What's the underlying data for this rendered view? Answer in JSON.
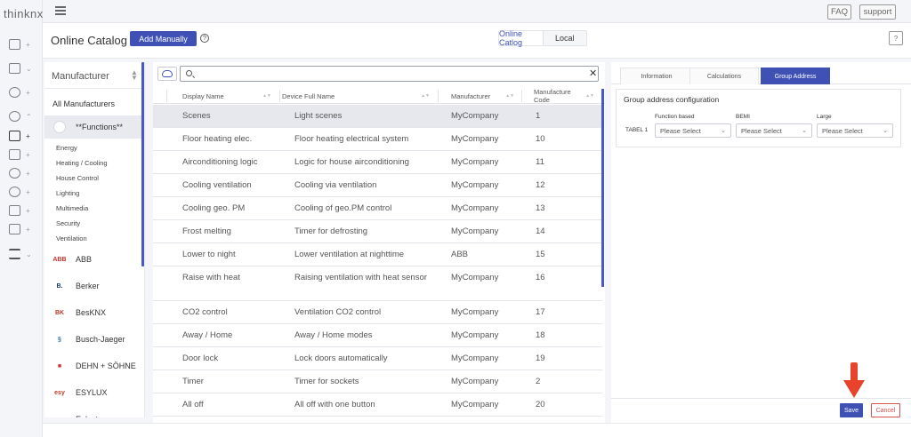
{
  "app": {
    "logo": "thinknx"
  },
  "topbar": {
    "faq": "FAQ",
    "support": "support"
  },
  "header": {
    "title": "Online Catalog",
    "add_manually": "Add Manually",
    "help": "?",
    "toggle_online": "Online Catlog",
    "toggle_local": "Local",
    "side_button": "?"
  },
  "manufacturer": {
    "title": "Manufacturer",
    "all": "All Manufacturers",
    "functions": "**Functions**",
    "subcategories": [
      "Energy",
      "Heating / Cooling",
      "House Control",
      "Lighting",
      "Multimedia",
      "Security",
      "Ventilation"
    ],
    "brands": [
      {
        "name": "ABB",
        "logo": "ABB",
        "color": "#d32f2f"
      },
      {
        "name": "Berker",
        "logo": "B.",
        "color": "#1a3a6b"
      },
      {
        "name": "BesKNX",
        "logo": "BK",
        "color": "#c0392b"
      },
      {
        "name": "Busch-Jaeger",
        "logo": "§",
        "color": "#2b6cb0"
      },
      {
        "name": "DEHN + SÖHNE",
        "logo": "■",
        "color": "#d32f2f"
      },
      {
        "name": "ESYLUX",
        "logo": "esy",
        "color": "#c0392b"
      },
      {
        "name": "Eelectron",
        "logo": "—",
        "color": "#2b6cb0"
      }
    ]
  },
  "search": {
    "placeholder": "",
    "value": "",
    "clear": "✕"
  },
  "table": {
    "columns": [
      "Display Name",
      "Device Full Name",
      "Manufacturer",
      "Manufacture Code"
    ],
    "rows": [
      {
        "display": "Scenes",
        "full": "Light scenes",
        "mfr": "MyCompany",
        "code": "1",
        "selected": true
      },
      {
        "display": "Floor heating elec.",
        "full": "Floor heating electrical system",
        "mfr": "MyCompany",
        "code": "10"
      },
      {
        "display": "Airconditioning logic",
        "full": "Logic for house airconditioning",
        "mfr": "MyCompany",
        "code": "11"
      },
      {
        "display": "Cooling ventilation",
        "full": "Cooling via ventilation",
        "mfr": "MyCompany",
        "code": "12"
      },
      {
        "display": "Cooling geo. PM",
        "full": "Cooling of geo.PM control",
        "mfr": "MyCompany",
        "code": "13"
      },
      {
        "display": "Frost melting",
        "full": "Timer for defrosting",
        "mfr": "MyCompany",
        "code": "14"
      },
      {
        "display": "Lower to night",
        "full": "Lower ventilation at nighttime",
        "mfr": "ABB",
        "code": "15"
      },
      {
        "display": "Raise with heat",
        "full": "Raising ventilation with heat sensor",
        "mfr": "MyCompany",
        "code": "16",
        "tall": true
      },
      {
        "display": "CO2 control",
        "full": "Ventilation CO2 control",
        "mfr": "MyCompany",
        "code": "17"
      },
      {
        "display": "Away / Home",
        "full": "Away / Home modes",
        "mfr": "MyCompany",
        "code": "18"
      },
      {
        "display": "Door lock",
        "full": "Lock doors automatically",
        "mfr": "MyCompany",
        "code": "19"
      },
      {
        "display": "Timer",
        "full": "Timer for sockets",
        "mfr": "MyCompany",
        "code": "2"
      },
      {
        "display": "All off",
        "full": "All off with one button",
        "mfr": "MyCompany",
        "code": "20"
      }
    ]
  },
  "right": {
    "tabs": [
      "Information",
      "Calculations",
      "Group Address"
    ],
    "active_tab": "Group Address",
    "ga_title": "Group address configuration",
    "col_function": "Function based",
    "col_bemi": "BEMI",
    "col_large": "Large",
    "row_label": "TABEL 1",
    "select_placeholder": "Please Select",
    "save": "Save",
    "cancel": "Cancel"
  },
  "colors": {
    "accent": "#3f51b5",
    "danger": "#d9534f",
    "arrow": "#e8432d"
  }
}
